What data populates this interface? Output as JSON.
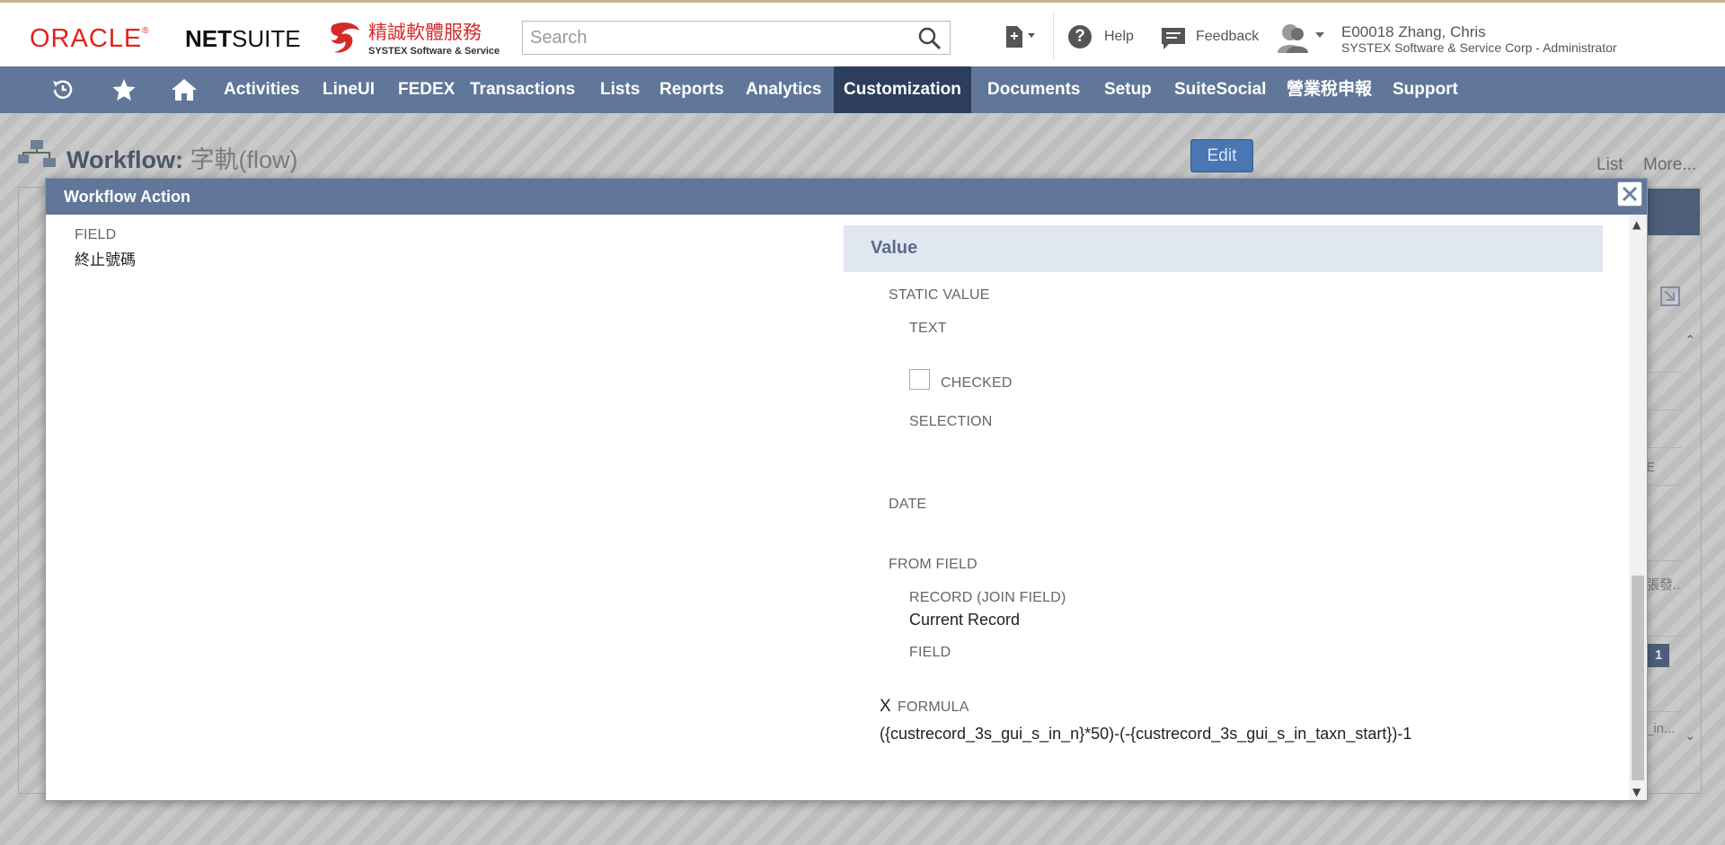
{
  "header": {
    "oracle_logo": "ORACLE",
    "netsuite_logo_bold": "NET",
    "netsuite_logo_rest": "SUITE",
    "company_logo_cn": "精誠軟體服務",
    "company_logo_en": "SYSTEX Software & Service",
    "search_placeholder": "Search",
    "help_label": "Help",
    "feedback_label": "Feedback",
    "user_name": "E00018 Zhang, Chris",
    "user_role": "SYSTEX Software & Service Corp - Administrator"
  },
  "nav": {
    "items": [
      {
        "label": "Activities"
      },
      {
        "label": "LineUI"
      },
      {
        "label": "FEDEX"
      },
      {
        "label": "Transactions"
      },
      {
        "label": "Lists"
      },
      {
        "label": "Reports"
      },
      {
        "label": "Analytics"
      },
      {
        "label": "Customization",
        "active": true
      },
      {
        "label": "Documents"
      },
      {
        "label": "Setup"
      },
      {
        "label": "SuiteSocial"
      },
      {
        "label": "營業稅申報"
      },
      {
        "label": "Support"
      }
    ]
  },
  "page": {
    "title_prefix": "Workflow:",
    "title_name": "字軌(flow)",
    "edit_label": "Edit",
    "list_label": "List",
    "more_label": "More...",
    "bg_badge": "1",
    "bg_text_e": "E",
    "bg_text_zhang": "張發..",
    "bg_text_in": "_in..."
  },
  "modal": {
    "title": "Workflow Action",
    "field_label": "FIELD",
    "field_value": "終止號碼",
    "value_section": "Value",
    "static_value_label": "STATIC VALUE",
    "text_label": "TEXT",
    "checked_label": "CHECKED",
    "selection_label": "SELECTION",
    "date_label": "DATE",
    "from_field_label": "FROM FIELD",
    "record_join_label": "RECORD (JOIN FIELD)",
    "record_join_value": "Current Record",
    "from_field_field_label": "FIELD",
    "formula_marker": "X",
    "formula_label": "FORMULA",
    "formula_value": "({custrecord_3s_gui_s_in_n}*50)-(-{custrecord_3s_gui_s_in_taxn_start})-1"
  },
  "colors": {
    "nav_bg": "#607799",
    "nav_active": "#2d3e5c",
    "oracle_red": "#e2231a",
    "value_band": "#e1e7f0"
  }
}
